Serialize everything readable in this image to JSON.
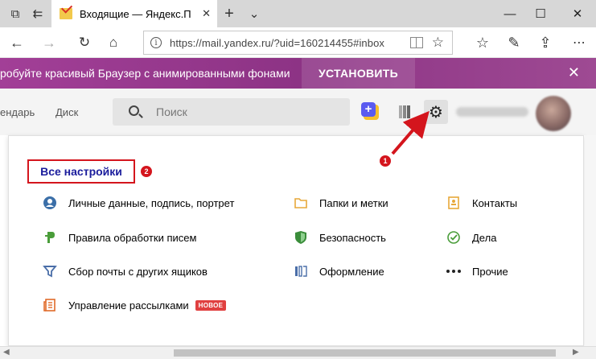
{
  "browser": {
    "tab_title": "Входящие — Яндекс.П",
    "url": "https://mail.yandex.ru/?uid=160214455#inbox"
  },
  "promo": {
    "text": "робуйте красивый Браузер с анимированными фонами",
    "install_label": "УСТАНОВИТЬ"
  },
  "header": {
    "calendar": "ендарь",
    "disk": "Диск",
    "search_placeholder": "Поиск"
  },
  "settings": {
    "all_settings": "Все настройки",
    "columns": [
      [
        {
          "label": "Личные данные, подпись, портрет",
          "icon": "person-icon"
        },
        {
          "label": "Правила обработки писем",
          "icon": "rules-icon"
        },
        {
          "label": "Сбор почты с других ящиков",
          "icon": "funnel-icon"
        },
        {
          "label": "Управление рассылками",
          "icon": "newsletter-icon",
          "badge": "НОВОЕ"
        }
      ],
      [
        {
          "label": "Папки и метки",
          "icon": "folder-icon"
        },
        {
          "label": "Безопасность",
          "icon": "shield-icon"
        },
        {
          "label": "Оформление",
          "icon": "themes-icon"
        }
      ],
      [
        {
          "label": "Контакты",
          "icon": "contacts-icon"
        },
        {
          "label": "Дела",
          "icon": "check-icon"
        },
        {
          "label": "Прочие",
          "icon": "more-icon"
        }
      ]
    ]
  },
  "annotations": {
    "marker_1": "1",
    "marker_2": "2"
  },
  "colors": {
    "promo_bg": "#9b3b8f",
    "annotation_red": "#d4151d",
    "link_blue": "#1a1c9c"
  }
}
